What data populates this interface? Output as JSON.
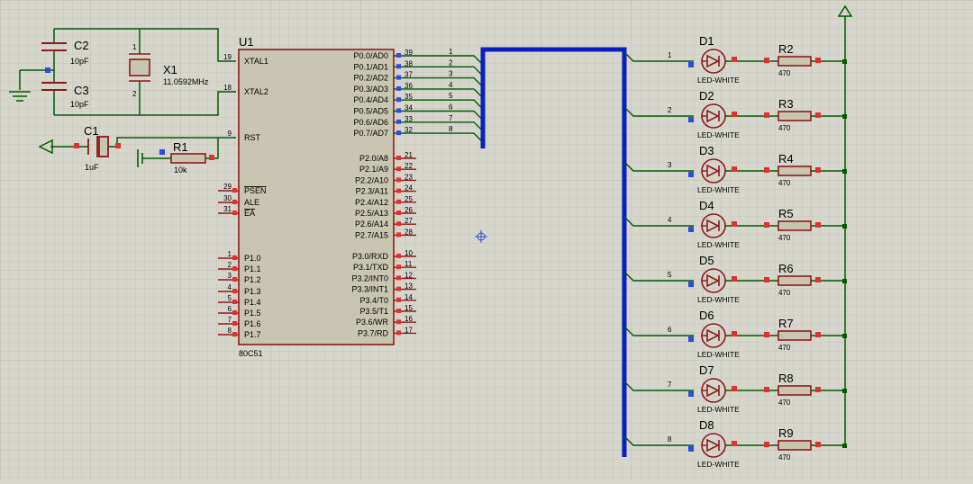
{
  "colors": {
    "background": "#d6d6cc",
    "grid": "#c4c4ba",
    "wire": "#005a00",
    "bus": "#0a1fbf",
    "component": "#8b1a1a",
    "chip_fill": "#c8c6b0",
    "pin_end_red": "#e03030",
    "pin_end_blue": "#2c4ce0",
    "text": "#000000"
  },
  "mcu": {
    "ref": "U1",
    "part": "80C51",
    "left_pins": [
      {
        "num": "19",
        "name": "XTAL1"
      },
      {
        "num": "18",
        "name": "XTAL2"
      },
      {
        "num": "9",
        "name": "RST"
      },
      {
        "num": "29",
        "name": "PSEN"
      },
      {
        "num": "30",
        "name": "ALE"
      },
      {
        "num": "31",
        "name": "EA"
      },
      {
        "num": "1",
        "name": "P1.0"
      },
      {
        "num": "2",
        "name": "P1.1"
      },
      {
        "num": "3",
        "name": "P1.2"
      },
      {
        "num": "4",
        "name": "P1.3"
      },
      {
        "num": "5",
        "name": "P1.4"
      },
      {
        "num": "6",
        "name": "P1.5"
      },
      {
        "num": "7",
        "name": "P1.6"
      },
      {
        "num": "8",
        "name": "P1.7"
      }
    ],
    "right_pins": [
      {
        "num": "39",
        "name": "P0.0/AD0"
      },
      {
        "num": "38",
        "name": "P0.1/AD1"
      },
      {
        "num": "37",
        "name": "P0.2/AD2"
      },
      {
        "num": "36",
        "name": "P0.3/AD3"
      },
      {
        "num": "35",
        "name": "P0.4/AD4"
      },
      {
        "num": "34",
        "name": "P0.5/AD5"
      },
      {
        "num": "33",
        "name": "P0.6/AD6"
      },
      {
        "num": "32",
        "name": "P0.7/AD7"
      },
      {
        "num": "21",
        "name": "P2.0/A8"
      },
      {
        "num": "22",
        "name": "P2.1/A9"
      },
      {
        "num": "23",
        "name": "P2.2/A10"
      },
      {
        "num": "24",
        "name": "P2.3/A11"
      },
      {
        "num": "25",
        "name": "P2.4/A12"
      },
      {
        "num": "26",
        "name": "P2.5/A13"
      },
      {
        "num": "27",
        "name": "P2.6/A14"
      },
      {
        "num": "28",
        "name": "P2.7/A15"
      },
      {
        "num": "10",
        "name": "P3.0/RXD"
      },
      {
        "num": "11",
        "name": "P3.1/TXD"
      },
      {
        "num": "12",
        "name": "P3.2/INT0"
      },
      {
        "num": "13",
        "name": "P3.3/INT1"
      },
      {
        "num": "14",
        "name": "P3.4/T0"
      },
      {
        "num": "15",
        "name": "P3.5/T1"
      },
      {
        "num": "16",
        "name": "P3.6/WR"
      },
      {
        "num": "17",
        "name": "P3.7/RD"
      }
    ]
  },
  "passives": {
    "c2": {
      "ref": "C2",
      "value": "10pF"
    },
    "c3": {
      "ref": "C3",
      "value": "10pF"
    },
    "x1": {
      "ref": "X1",
      "value": "11.0592MHz",
      "pin_a": "1",
      "pin_b": "2"
    },
    "c1": {
      "ref": "C1",
      "value": "1uF"
    },
    "r1": {
      "ref": "R1",
      "value": "10k"
    }
  },
  "bus_labels": [
    "1",
    "2",
    "3",
    "4",
    "5",
    "6",
    "7",
    "8"
  ],
  "leds": [
    {
      "ref": "D1",
      "type": "LED-WHITE",
      "net": "1",
      "res_ref": "R2",
      "res_value": "470"
    },
    {
      "ref": "D2",
      "type": "LED-WHITE",
      "net": "2",
      "res_ref": "R3",
      "res_value": "470"
    },
    {
      "ref": "D3",
      "type": "LED-WHITE",
      "net": "3",
      "res_ref": "R4",
      "res_value": "470"
    },
    {
      "ref": "D4",
      "type": "LED-WHITE",
      "net": "4",
      "res_ref": "R5",
      "res_value": "470"
    },
    {
      "ref": "D5",
      "type": "LED-WHITE",
      "net": "5",
      "res_ref": "R6",
      "res_value": "470"
    },
    {
      "ref": "D6",
      "type": "LED-WHITE",
      "net": "6",
      "res_ref": "R7",
      "res_value": "470"
    },
    {
      "ref": "D7",
      "type": "LED-WHITE",
      "net": "7",
      "res_ref": "R8",
      "res_value": "470"
    },
    {
      "ref": "D8",
      "type": "LED-WHITE",
      "net": "8",
      "res_ref": "R9",
      "res_value": "470"
    }
  ]
}
